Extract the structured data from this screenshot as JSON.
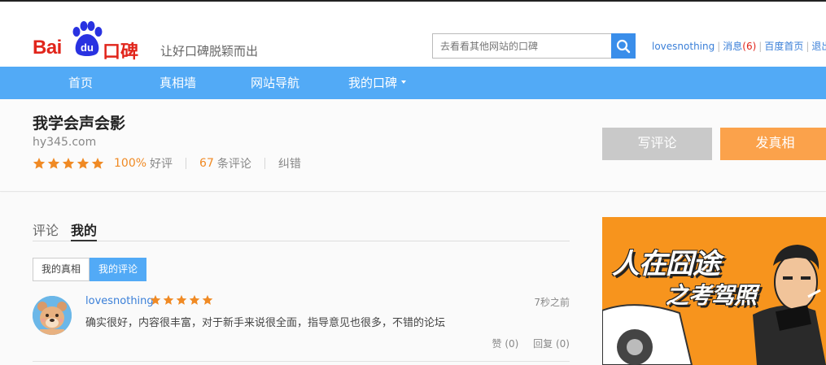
{
  "header": {
    "logo_text_bai": "Bai",
    "logo_text_du": "du",
    "logo_text_koubei": "口碑",
    "slogan": "让好口碑脱颖而出",
    "search_placeholder": "去看看其他网站的口碑",
    "user": {
      "username": "lovesnothing",
      "messages_label": "消息",
      "messages_count": "(6)",
      "baidu_home": "百度首页",
      "logout": "退出"
    }
  },
  "nav": {
    "items": [
      "首页",
      "真相墙",
      "网站导航",
      "我的口碑"
    ]
  },
  "site": {
    "title": "我学会声会影",
    "domain": "hy345.com",
    "rating_stars": 5,
    "positive_pct": "100%",
    "positive_label": "好评",
    "review_count": "67",
    "review_label": "条评论",
    "correct_label": "纠错",
    "write_review_button": "写评论",
    "post_truth_button": "发真相"
  },
  "tabs": {
    "items": [
      "评论",
      "我的"
    ],
    "active": "我的"
  },
  "subtabs": {
    "items": [
      "我的真相",
      "我的评论"
    ],
    "active": "我的评论"
  },
  "comments": [
    {
      "user": "lovesnothing",
      "stars": 5,
      "time": "7秒之前",
      "text": "确实很好，内容很丰富，对于新手来说很全面，指导意见也很多，不错的论坛",
      "likes_label": "赞 (0)",
      "reply_label": "回复 (0)"
    }
  ],
  "ad": {
    "title": "人在囧途",
    "subtitle": "之考驾照"
  },
  "colors": {
    "brand_red": "#e1251b",
    "brand_blue": "#52aaf6",
    "star_orange": "#f08a24",
    "button_orange": "#fba24b"
  }
}
